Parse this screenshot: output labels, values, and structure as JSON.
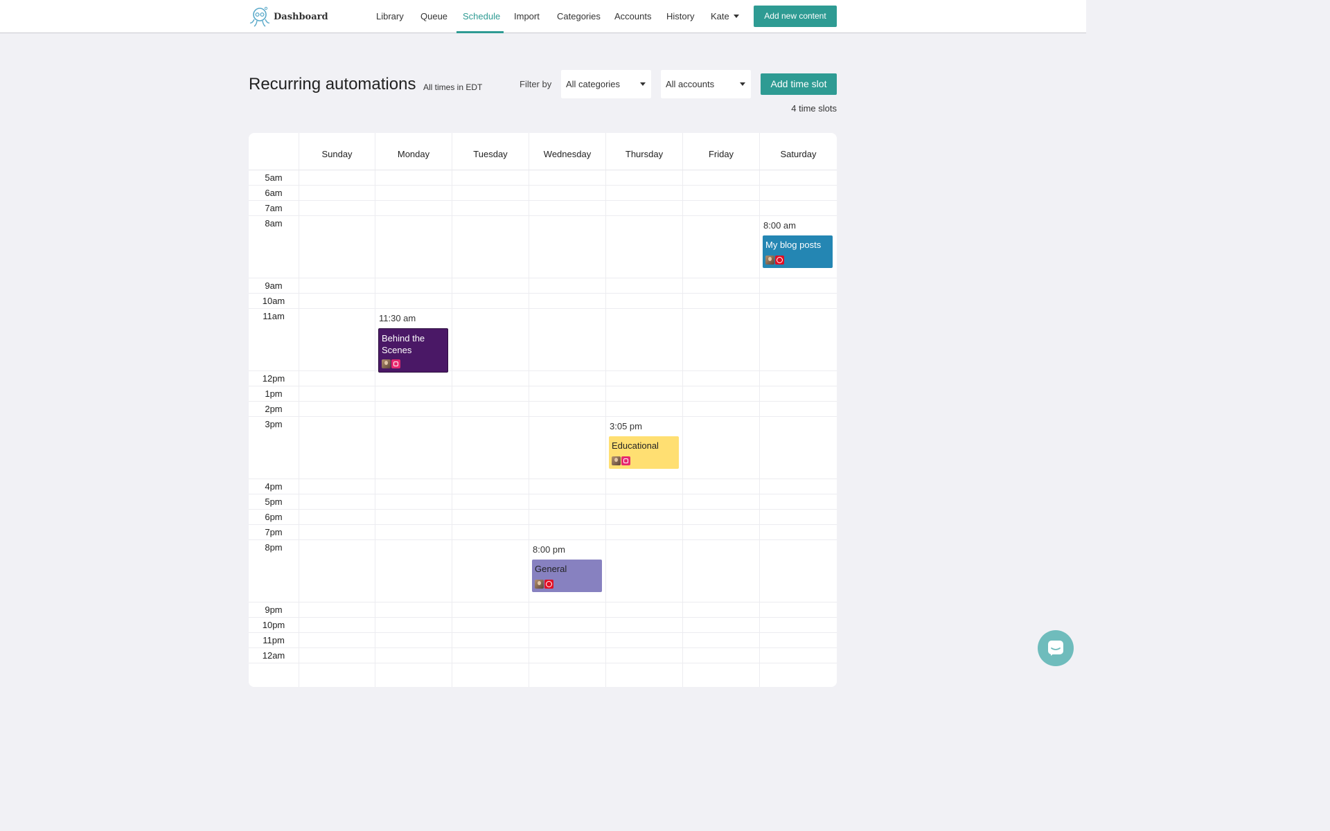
{
  "header": {
    "brand": "Dashboard",
    "nav": [
      "Library",
      "Queue",
      "Schedule",
      "Import",
      "Categories",
      "Accounts",
      "History"
    ],
    "active_nav": "Schedule",
    "user": "Kate",
    "add_content_label": "Add new content"
  },
  "page": {
    "title": "Recurring automations",
    "timezone_note": "All times in EDT",
    "filter_label": "Filter by",
    "category_filter": "All categories",
    "account_filter": "All accounts",
    "add_slot_label": "Add time slot",
    "slot_count": "4 time slots"
  },
  "calendar": {
    "days": [
      "Sunday",
      "Monday",
      "Tuesday",
      "Wednesday",
      "Thursday",
      "Friday",
      "Saturday"
    ],
    "hours": [
      "5am",
      "6am",
      "7am",
      "8am",
      "9am",
      "10am",
      "11am",
      "12pm",
      "1pm",
      "2pm",
      "3pm",
      "4pm",
      "5pm",
      "6pm",
      "7pm",
      "8pm",
      "9pm",
      "10pm",
      "11pm",
      "12am"
    ],
    "events": [
      {
        "time": "8:00 am",
        "title": "My blog posts",
        "day": "Saturday",
        "hour": "8am",
        "color": "#2486b3",
        "text_color": "#ffffff",
        "network": "pinterest-icon"
      },
      {
        "time": "11:30 am",
        "title": "Behind the Scenes",
        "day": "Monday",
        "hour": "11am",
        "color": "#4a1866",
        "text_color": "#ffffff",
        "network": "instagram-icon"
      },
      {
        "time": "3:05 pm",
        "title": "Educational",
        "day": "Thursday",
        "hour": "3pm",
        "color": "#ffdf72",
        "text_color": "#222222",
        "network": "instagram-icon"
      },
      {
        "time": "8:00 pm",
        "title": "General",
        "day": "Wednesday",
        "hour": "8pm",
        "color": "#8781c0",
        "text_color": "#222222",
        "network": "pinterest-icon"
      }
    ]
  },
  "colors": {
    "accent": "#2e9b93",
    "background": "#f1f1f5"
  }
}
